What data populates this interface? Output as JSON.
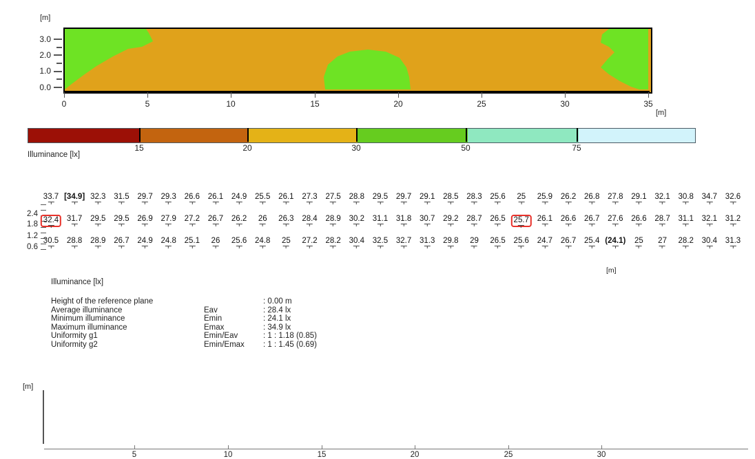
{
  "isolux_plot": {
    "y_unit": "[m]",
    "x_unit": "[m]",
    "y_ticks": [
      "3.0",
      "2.0",
      "1.0",
      "0.0"
    ],
    "x_ticks": [
      "0",
      "5",
      "10",
      "15",
      "20",
      "25",
      "30",
      "35"
    ],
    "colors": {
      "field_gold": "#e0a21b",
      "field_green": "#6ee324",
      "border": "#000000"
    }
  },
  "legend": {
    "caption": "Illuminance [lx]",
    "tick_labels": [
      "15",
      "20",
      "30",
      "50",
      "75"
    ],
    "segments": [
      {
        "name": "below-15",
        "color": "#9c1006"
      },
      {
        "name": "15-20",
        "color": "#c3640f"
      },
      {
        "name": "20-30",
        "color": "#e4b217"
      },
      {
        "name": "30-50",
        "color": "#66cc1f"
      },
      {
        "name": "50-75",
        "color": "#8fe8c0"
      },
      {
        "name": "above-75",
        "color": "#d2f3fb"
      }
    ]
  },
  "value_grid": {
    "y_unit": "[m]",
    "x_unit": "[m]",
    "y_ticks": [
      "2.4",
      "1.8",
      "1.2",
      "0.6"
    ],
    "x_ticks": [
      "5",
      "10",
      "15",
      "20",
      "25",
      "30"
    ],
    "rows": [
      {
        "name": "row-top",
        "values": [
          "33.7",
          "[34.9]",
          "32.3",
          "31.5",
          "29.7",
          "29.3",
          "26.6",
          "26.1",
          "24.9",
          "25.5",
          "26.1",
          "27.3",
          "27.5",
          "28.8",
          "29.5",
          "29.7",
          "29.1",
          "28.5",
          "28.3",
          "25.6",
          "25",
          "25.9",
          "26.2",
          "26.8",
          "27.8",
          "29.1",
          "32.1",
          "30.8",
          "34.7",
          "32.6"
        ],
        "highlight_index": 1,
        "highlight_style": "bold"
      },
      {
        "name": "row-middle",
        "values": [
          "32.4",
          "31.7",
          "29.5",
          "29.5",
          "26.9",
          "27.9",
          "27.2",
          "26.7",
          "26.2",
          "26",
          "26.3",
          "28.4",
          "28.9",
          "30.2",
          "31.1",
          "31.8",
          "30.7",
          "29.2",
          "28.7",
          "26.5",
          "25.7",
          "26.1",
          "26.6",
          "26.7",
          "27.6",
          "26.6",
          "28.7",
          "31.1",
          "32.1",
          "31.2"
        ],
        "red_box_indices": [
          0,
          20
        ]
      },
      {
        "name": "row-bottom",
        "values": [
          "30.5",
          "28.8",
          "28.9",
          "26.7",
          "24.9",
          "24.8",
          "25.1",
          "26",
          "25.6",
          "24.8",
          "25",
          "27.2",
          "28.2",
          "30.4",
          "32.5",
          "32.7",
          "31.3",
          "29.8",
          "29",
          "26.5",
          "25.6",
          "24.7",
          "26.7",
          "25.4",
          "(24.1)",
          "25",
          "27",
          "28.2",
          "30.4",
          "31.3"
        ],
        "highlight_index": 24,
        "highlight_style": "bold"
      }
    ]
  },
  "summary": {
    "caption": "Illuminance [lx]",
    "rows": [
      {
        "label": "Height of the reference plane",
        "symbol": "",
        "value": ": 0.00 m"
      },
      {
        "label": "Average illuminance",
        "symbol": "Eav",
        "value": ": 28.4 lx"
      },
      {
        "label": "Minimum illuminance",
        "symbol": "Emin",
        "value": ": 24.1 lx"
      },
      {
        "label": "Maximum illuminance",
        "symbol": "Emax",
        "value": ": 34.9 lx"
      },
      {
        "label": "Uniformity g1",
        "symbol": "Emin/Eav",
        "value": ": 1 : 1.18 (0.85)"
      },
      {
        "label": "Uniformity g2",
        "symbol": "Emin/Emax",
        "value": ": 1 : 1.45 (0.69)"
      }
    ]
  }
}
